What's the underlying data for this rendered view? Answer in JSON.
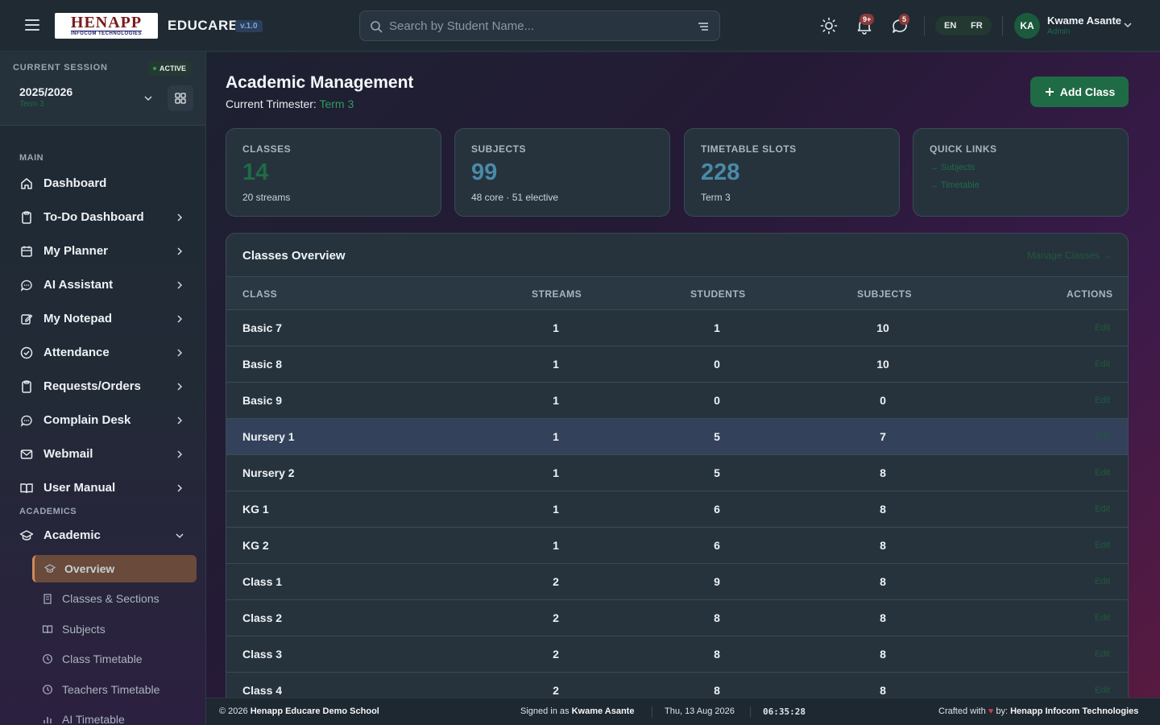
{
  "header": {
    "logo_main": "HENAPP",
    "logo_sub": "INFOCOM TECHNOLOGIES",
    "app_name": "EDUCARE",
    "version": "v.1.0",
    "search_placeholder": "Search by Student Name...",
    "notifications_badge": "9+",
    "messages_badge": "5",
    "lang_en": "EN",
    "lang_fr": "FR",
    "avatar_initials": "KA",
    "user_name": "Kwame Asante",
    "user_role": "Admin",
    "icons": {
      "menu": "menu-icon",
      "search": "search-icon",
      "filter": "filter-icon",
      "theme": "sun-icon",
      "notifications": "bell-icon",
      "messages": "chat-icon",
      "user_menu": "chevron-down-icon"
    }
  },
  "sidebar": {
    "session_label": "CURRENT SESSION",
    "session_status": "ACTIVE",
    "session_year": "2025/2026",
    "session_term": "Term 3",
    "section_main": "MAIN",
    "section_academics": "ACADEMICS",
    "main_items": [
      {
        "label": "Dashboard",
        "icon": "home-icon"
      },
      {
        "label": "To-Do Dashboard",
        "icon": "clipboard-icon"
      },
      {
        "label": "My Planner",
        "icon": "calendar-icon"
      },
      {
        "label": "AI Assistant",
        "icon": "chat-icon"
      },
      {
        "label": "My Notepad",
        "icon": "edit-icon"
      },
      {
        "label": "Attendance",
        "icon": "check-circle-icon"
      },
      {
        "label": "Requests/Orders",
        "icon": "clipboard-icon"
      },
      {
        "label": "Complain Desk",
        "icon": "chat-icon"
      },
      {
        "label": "Webmail",
        "icon": "mail-icon"
      },
      {
        "label": "User Manual",
        "icon": "book-icon"
      }
    ],
    "academic": {
      "label": "Academic",
      "icon": "graduation-cap-icon"
    },
    "academic_sub": [
      {
        "label": "Overview",
        "icon": "graduation-cap-icon"
      },
      {
        "label": "Classes & Sections",
        "icon": "building-icon"
      },
      {
        "label": "Subjects",
        "icon": "book-icon"
      },
      {
        "label": "Class Timetable",
        "icon": "clock-icon"
      },
      {
        "label": "Teachers Timetable",
        "icon": "clock-icon"
      },
      {
        "label": "AI Timetable",
        "icon": "chart-icon"
      }
    ]
  },
  "main": {
    "title": "Academic Management",
    "trimester_label": "Current Trimester:",
    "trimester_value": "Term 3",
    "add_button": "Add Class",
    "stats": [
      {
        "label": "CLASSES",
        "value": "14",
        "sub": "20 streams",
        "color": "#1f6b45"
      },
      {
        "label": "SUBJECTS",
        "value": "99",
        "sub": "48 core · 51 elective",
        "color": "#4a8aa8"
      },
      {
        "label": "TIMETABLE SLOTS",
        "value": "228",
        "sub": "Term 3",
        "color": "#4a8aa8"
      }
    ],
    "quick_links": {
      "label": "QUICK LINKS",
      "links": [
        "→ Subjects",
        "→ Timetable"
      ]
    },
    "table": {
      "title": "Classes Overview",
      "manage_link": "Manage Classes →",
      "columns": [
        "CLASS",
        "STREAMS",
        "STUDENTS",
        "SUBJECTS",
        "ACTIONS"
      ],
      "action_label": "Edit",
      "rows": [
        {
          "class": "Basic 7",
          "streams": "1",
          "students": "1",
          "subjects": "10"
        },
        {
          "class": "Basic 8",
          "streams": "1",
          "students": "0",
          "subjects": "10"
        },
        {
          "class": "Basic 9",
          "streams": "1",
          "students": "0",
          "subjects": "0"
        },
        {
          "class": "Nursery 1",
          "streams": "1",
          "students": "5",
          "subjects": "7"
        },
        {
          "class": "Nursery 2",
          "streams": "1",
          "students": "5",
          "subjects": "8"
        },
        {
          "class": "KG 1",
          "streams": "1",
          "students": "6",
          "subjects": "8"
        },
        {
          "class": "KG 2",
          "streams": "1",
          "students": "6",
          "subjects": "8"
        },
        {
          "class": "Class 1",
          "streams": "2",
          "students": "9",
          "subjects": "8"
        },
        {
          "class": "Class 2",
          "streams": "2",
          "students": "8",
          "subjects": "8"
        },
        {
          "class": "Class 3",
          "streams": "2",
          "students": "8",
          "subjects": "8"
        },
        {
          "class": "Class 4",
          "streams": "2",
          "students": "8",
          "subjects": "8"
        }
      ]
    }
  },
  "footer": {
    "copyright_prefix": "© 2026",
    "school": "Henapp Educare Demo School",
    "signed_prefix": "Signed in as",
    "signed_user": "Kwame Asante",
    "date": "Thu, 13 Aug 2026",
    "time": "06:35:28",
    "crafted_prefix": "Crafted with",
    "crafted_by": "by:",
    "company": "Henapp Infocom Technologies"
  }
}
